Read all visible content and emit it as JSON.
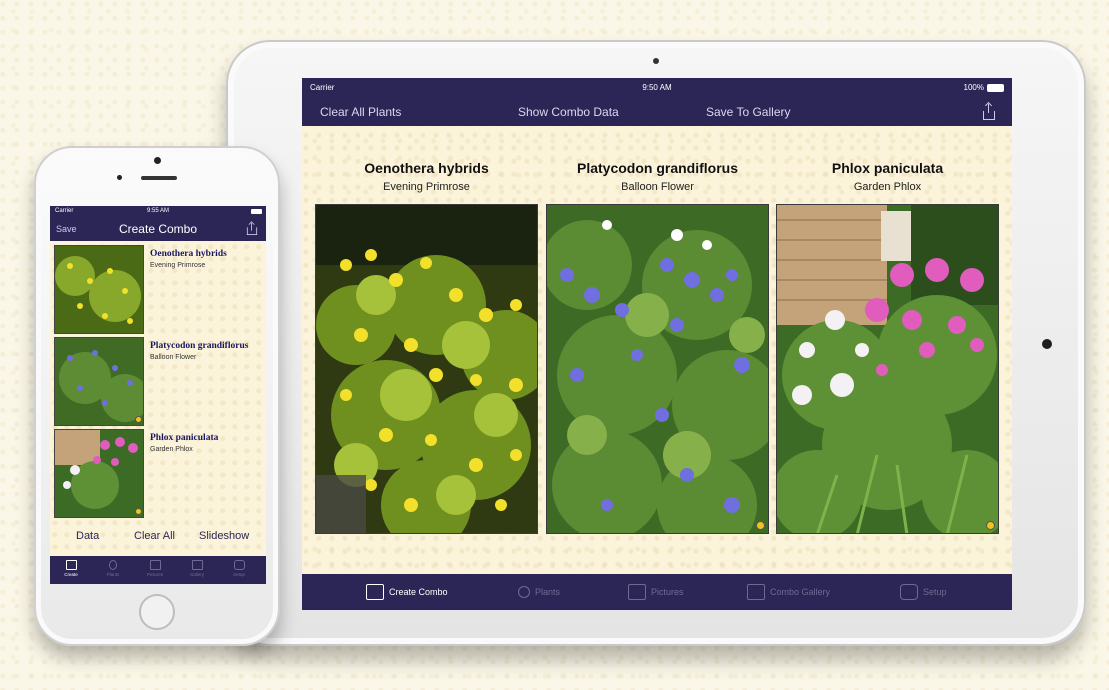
{
  "ipad": {
    "status": {
      "carrier": "Carrier",
      "time": "9:50 AM",
      "battery": "100%"
    },
    "nav": {
      "clear_all": "Clear All Plants",
      "show_data": "Show Combo Data",
      "save_gallery": "Save To Gallery",
      "share_icon": "share-icon"
    },
    "plants": [
      {
        "scientific": "Oenothera hybrids",
        "common": "Evening Primrose"
      },
      {
        "scientific": "Platycodon grandiflorus",
        "common": "Balloon Flower"
      },
      {
        "scientific": "Phlox paniculata",
        "common": "Garden Phlox"
      }
    ],
    "tabs": [
      {
        "label": "Create Combo",
        "icon": "create-combo-icon",
        "active": true
      },
      {
        "label": "Plants",
        "icon": "plant-icon",
        "active": false
      },
      {
        "label": "Pictures",
        "icon": "pictures-icon",
        "active": false
      },
      {
        "label": "Combo Gallery",
        "icon": "gallery-icon",
        "active": false
      },
      {
        "label": "Setup",
        "icon": "gear-icon",
        "active": false
      }
    ]
  },
  "iphone": {
    "status": {
      "carrier": "Carrier",
      "time": "9:55 AM"
    },
    "nav": {
      "save": "Save",
      "title": "Create Combo",
      "share_icon": "share-icon"
    },
    "plants": [
      {
        "scientific": "Oenothera hybrids",
        "common": "Evening Primrose"
      },
      {
        "scientific": "Platycodon grandiflorus",
        "common": "Balloon Flower"
      },
      {
        "scientific": "Phlox paniculata",
        "common": "Garden Phlox"
      }
    ],
    "actions": {
      "data": "Data",
      "clear_all": "Clear All",
      "slideshow": "Slideshow"
    },
    "tabs": [
      {
        "label": "Create",
        "active": true
      },
      {
        "label": "Plants",
        "active": false
      },
      {
        "label": "Pictures",
        "active": false
      },
      {
        "label": "Gallery",
        "active": false
      },
      {
        "label": "Setup",
        "active": false
      }
    ]
  },
  "colors": {
    "bar": "#2c2656",
    "paper": "#fbf4da",
    "indicator": "#f0c419"
  }
}
